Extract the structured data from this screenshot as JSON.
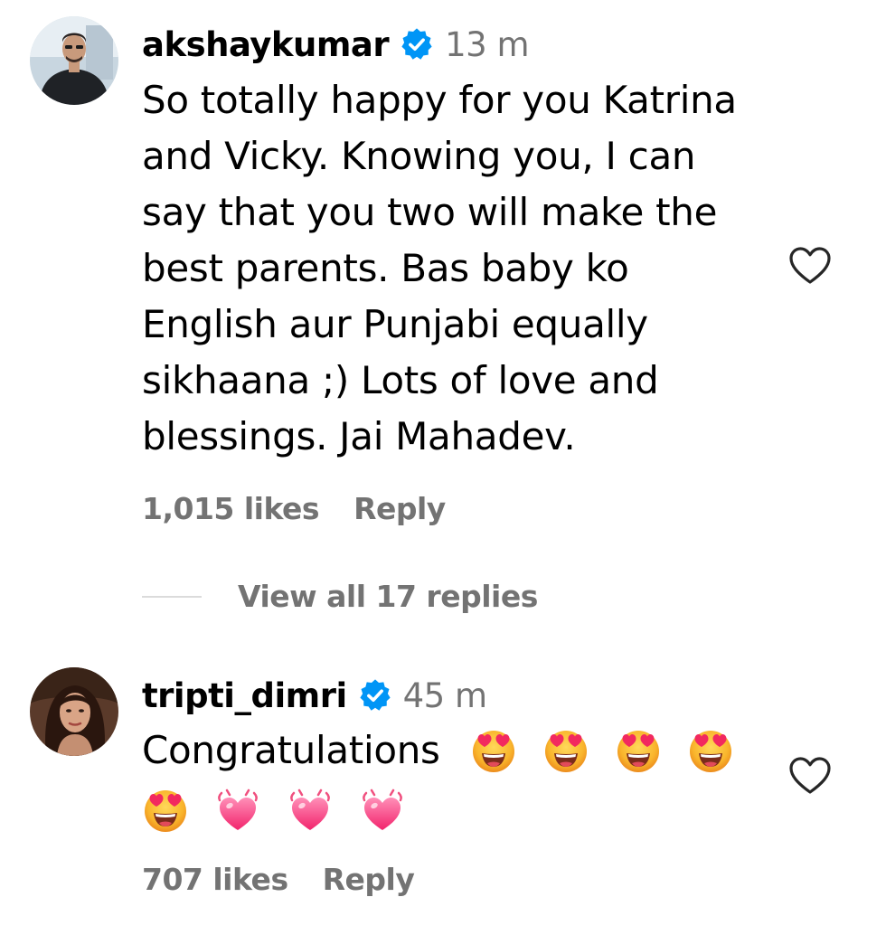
{
  "comments": [
    {
      "username": "akshaykumar",
      "verified": true,
      "timestamp": "13 m",
      "lines": [
        "So totally happy for you Katrina",
        "and Vicky. Knowing you, I can",
        "say that you two will make the",
        "best parents. Bas baby ko",
        "English aur Punjabi equally",
        "sikhaana ;) Lots of love and",
        "blessings. Jai Mahadev."
      ],
      "likes": "1,015 likes",
      "reply_label": "Reply",
      "view_replies": "View all 17 replies"
    },
    {
      "username": "tripti_dimri",
      "verified": true,
      "timestamp": "45 m",
      "text": "Congratulations",
      "emojis_line1": [
        "smiling-face-with-heart-eyes",
        "smiling-face-with-heart-eyes",
        "smiling-face-with-heart-eyes",
        "smiling-face-with-heart-eyes"
      ],
      "emojis_line2": [
        "smiling-face-with-heart-eyes",
        "growing-heart",
        "growing-heart",
        "growing-heart"
      ],
      "likes": "707 likes",
      "reply_label": "Reply"
    }
  ],
  "colors": {
    "verified_blue": "#0095f6",
    "secondary_text": "#737373",
    "divider": "#dbdbdb"
  },
  "icons": {
    "like": "heart-outline-icon",
    "verified": "verified-badge-icon"
  }
}
